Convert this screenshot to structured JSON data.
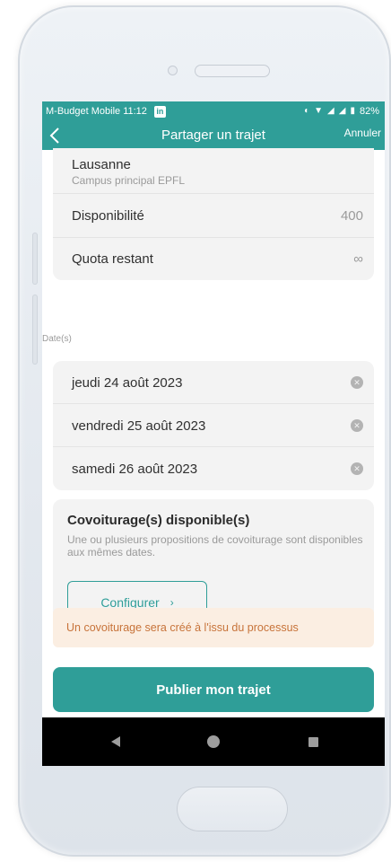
{
  "status_bar": {
    "carrier_time": "M-Budget Mobile 11:12",
    "app_badge": "in",
    "battery": "82%"
  },
  "nav": {
    "title": "Partager un trajet",
    "cancel": "Annuler",
    "back_icon": "chevron-left-icon"
  },
  "location": {
    "name": "Lausanne",
    "subtitle": "Campus principal EPFL"
  },
  "details": [
    {
      "label": "Disponibilité",
      "value": "400"
    },
    {
      "label": "Quota restant",
      "value": "∞"
    }
  ],
  "dates": {
    "section_label": "Date(s)",
    "items": [
      "jeudi 24 août 2023",
      "vendredi 25 août 2023",
      "samedi 26 août 2023"
    ]
  },
  "carpool": {
    "title": "Covoiturage(s) disponible(s)",
    "description": "Une ou plusieurs propositions de covoiturage sont disponibles aux mêmes dates.",
    "configure_label": "Configurer",
    "configure_chevron": "›"
  },
  "notice": "Un covoiturage sera créé à l'issu du processus",
  "publish_label": "Publier mon trajet",
  "colors": {
    "accent": "#2f9e98",
    "notice_bg": "#fbeee2",
    "notice_text": "#c7733a",
    "card_bg": "#f3f3f3"
  }
}
